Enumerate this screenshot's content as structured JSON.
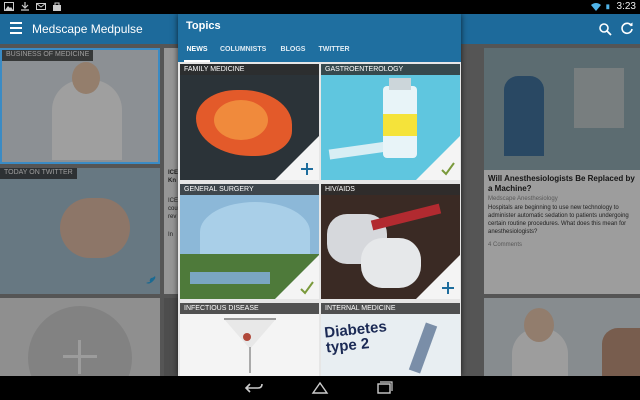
{
  "status_bar": {
    "time": "3:23",
    "left_icons": [
      "image-icon",
      "download-icon",
      "mail-icon",
      "bag-icon"
    ],
    "right_icons": [
      "wifi-icon",
      "battery-icon"
    ]
  },
  "app_bar": {
    "title": "Medscape Medpulse",
    "icons": [
      "menu-icon",
      "search-icon",
      "refresh-icon"
    ]
  },
  "background_cards": {
    "business_label": "BUSINESS OF MEDICINE",
    "twitter_label": "TODAY ON TWITTER",
    "partial_text": [
      "ICE",
      "Kn",
      "ICE",
      "cou",
      "rev",
      "In"
    ],
    "article": {
      "title": "Will Anesthesiologists Be Replaced by a Machine?",
      "source": "Medscape Anesthesiology",
      "summary": "Hospitals are beginning to use new technology to administer automatic sedation to patients undergoing certain routine procedures. What does this mean for anesthesiologists?",
      "comments": "4 Comments"
    }
  },
  "topics_dialog": {
    "title": "Topics",
    "tabs": [
      {
        "label": "NEWS",
        "active": true
      },
      {
        "label": "COLUMNISTS",
        "active": false
      },
      {
        "label": "BLOGS",
        "active": false
      },
      {
        "label": "TWITTER",
        "active": false
      }
    ],
    "topics": [
      {
        "label": "FAMILY MEDICINE",
        "state": "add"
      },
      {
        "label": "GASTROENTEROLOGY",
        "state": "selected"
      },
      {
        "label": "GENERAL SURGERY",
        "state": "selected"
      },
      {
        "label": "HIV/AIDS",
        "state": "add"
      },
      {
        "label": "INFECTIOUS DISEASE",
        "state": "none"
      },
      {
        "label": "INTERNAL MEDICINE",
        "state": "none"
      }
    ],
    "internal_medicine_image_text": "Diabetes type 2"
  },
  "colors": {
    "app_bar": "#1d6a9b",
    "dialog_header": "#1f6fa0",
    "plus_mark": "#1e6d9d",
    "check_mark": "#7a9a3c"
  },
  "nav_bar": {
    "buttons": [
      "back-icon",
      "home-icon",
      "recent-apps-icon"
    ]
  }
}
